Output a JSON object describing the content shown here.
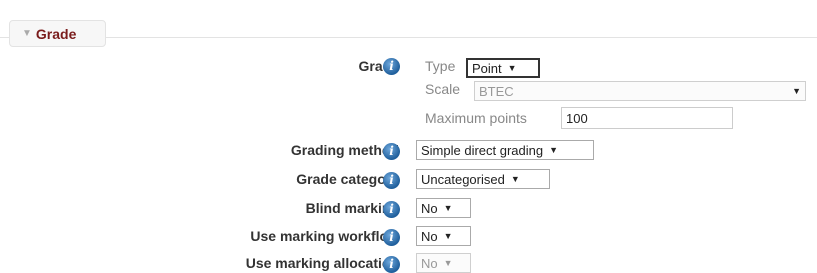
{
  "section": {
    "title": "Grade",
    "toggle_icon": "triangle-down-icon"
  },
  "grade": {
    "label": "Grade",
    "type_label": "Type",
    "type_value": "Point",
    "scale_label": "Scale",
    "scale_value": "BTEC",
    "max_points_label": "Maximum points",
    "max_points_value": "100"
  },
  "grading_method": {
    "label": "Grading method",
    "value": "Simple direct grading"
  },
  "grade_category": {
    "label": "Grade category",
    "value": "Uncategorised"
  },
  "blind_marking": {
    "label": "Blind marking",
    "value": "No"
  },
  "marking_workflow": {
    "label": "Use marking workflow",
    "value": "No"
  },
  "marking_allocation": {
    "label": "Use marking allocation",
    "value": "No"
  },
  "icons": {
    "help": "info-icon",
    "dropdown": "dropdown-arrow-icon"
  },
  "colors": {
    "legend_text": "#7a1c1c",
    "info_icon": "#1f5f9c",
    "legend_bg": "#f7f7f7"
  }
}
